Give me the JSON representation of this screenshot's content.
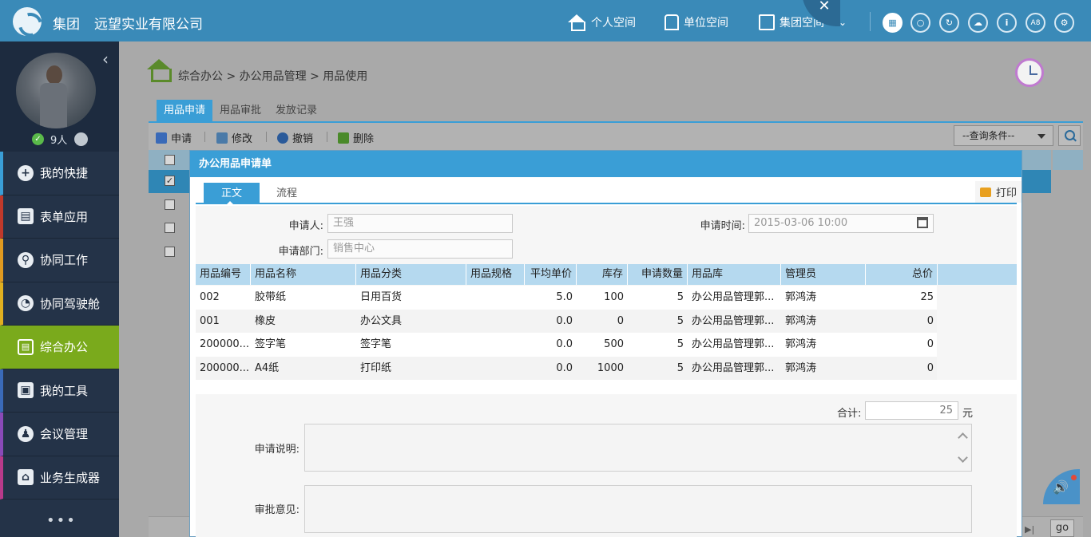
{
  "header": {
    "group": "集团",
    "company": "远望实业有限公司",
    "nav": [
      {
        "label": "个人空间"
      },
      {
        "label": "单位空间"
      },
      {
        "label": "集团空间"
      }
    ],
    "icons": [
      "grid-icon",
      "search-icon",
      "refresh-icon",
      "cloud-icon",
      "info-icon",
      "a8-icon",
      "settings-icon"
    ],
    "a8_label": "A8"
  },
  "sidebar": {
    "online_count": "9人",
    "items": [
      {
        "label": "我的快捷",
        "accent": "#3a9ed6"
      },
      {
        "label": "表单应用",
        "accent": "#c0392b"
      },
      {
        "label": "协同工作",
        "accent": "#e09a20"
      },
      {
        "label": "协同驾驶舱",
        "accent": "#e0b020"
      },
      {
        "label": "综合办公",
        "accent": "#7aaa1c"
      },
      {
        "label": "我的工具",
        "accent": "#3a6ab8"
      },
      {
        "label": "会议管理",
        "accent": "#8a4ab8"
      },
      {
        "label": "业务生成器",
        "accent": "#b83a8a"
      }
    ],
    "more": "•••"
  },
  "breadcrumb": "综合办公 > 办公用品管理 > 用品使用",
  "tabs": [
    "用品申请",
    "用品审批",
    "发放记录"
  ],
  "toolbar": {
    "apply": "申请",
    "edit": "修改",
    "revoke": "撤销",
    "delete": "删除",
    "query_placeholder": "--查询条件--"
  },
  "pager": {
    "go": "go"
  },
  "modal": {
    "title": "办公用品申请单",
    "tabs": [
      "正文",
      "流程"
    ],
    "print": "打印",
    "applicant_label": "申请人:",
    "applicant": "王强",
    "dept_label": "申请部门:",
    "dept": "销售中心",
    "time_label": "申请时间:",
    "time": "2015-03-06 10:00",
    "columns": [
      "用品编号",
      "用品名称",
      "用品分类",
      "用品规格",
      "平均单价",
      "库存",
      "申请数量",
      "用品库",
      "管理员",
      "总价"
    ],
    "rows": [
      [
        "002",
        "胶带纸",
        "日用百货",
        "",
        "5.0",
        "100",
        "5",
        "办公用品管理郭...",
        "郭鸿涛",
        "25"
      ],
      [
        "001",
        "橡皮",
        "办公文具",
        "",
        "0.0",
        "0",
        "5",
        "办公用品管理郭...",
        "郭鸿涛",
        "0"
      ],
      [
        "200000...",
        "签字笔",
        "签字笔",
        "",
        "0.0",
        "500",
        "5",
        "办公用品管理郭...",
        "郭鸿涛",
        "0"
      ],
      [
        "200000...",
        "A4纸",
        "打印纸",
        "",
        "0.0",
        "1000",
        "5",
        "办公用品管理郭...",
        "郭鸿涛",
        "0"
      ]
    ],
    "total_label": "合计:",
    "total": "25",
    "unit": "元",
    "desc_label": "申请说明:",
    "opinion_label": "审批意见:"
  }
}
